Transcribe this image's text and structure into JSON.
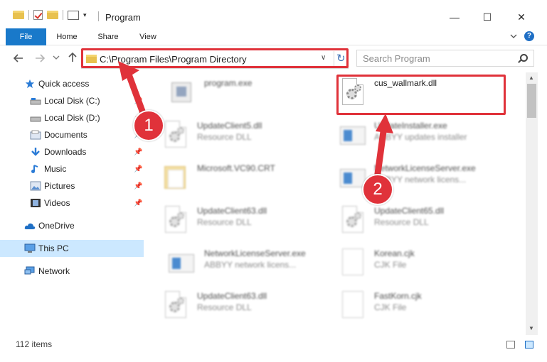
{
  "window": {
    "title": "Program",
    "minimize": "—",
    "maximize": "☐",
    "close": "✕"
  },
  "ribbon": {
    "tabs": [
      "File",
      "Home",
      "Share",
      "View"
    ],
    "help": "?"
  },
  "address": {
    "path": "C:\\Program Files\\Program Directory",
    "search_placeholder": "Search Program"
  },
  "nav_pane": {
    "quick_access": "Quick access",
    "items": [
      {
        "label": "Local Disk (C:)",
        "icon": "drive-icon",
        "pinned": true
      },
      {
        "label": "Local Disk (D:)",
        "icon": "drive-icon",
        "pinned": true
      },
      {
        "label": "Documents",
        "icon": "documents-icon",
        "pinned": true
      },
      {
        "label": "Downloads",
        "icon": "download-icon",
        "pinned": true
      },
      {
        "label": "Music",
        "icon": "music-icon",
        "pinned": true
      },
      {
        "label": "Pictures",
        "icon": "pictures-icon",
        "pinned": true
      },
      {
        "label": "Videos",
        "icon": "videos-icon",
        "pinned": true
      }
    ],
    "onedrive": "OneDrive",
    "this_pc": "This PC",
    "network": "Network"
  },
  "files": [
    {
      "name": "program.exe",
      "desc": "",
      "icon": "program-icon"
    },
    {
      "name": "cus_wallmark.dll",
      "desc": "",
      "icon": "dll-icon"
    },
    {
      "name": "UpdateClient5.dll",
      "desc": "Resource DLL",
      "icon": "dll-icon"
    },
    {
      "name": "UpdateInstaller.exe",
      "desc": "ABBYY updates installer",
      "icon": "exe-icon"
    },
    {
      "name": "Microsoft.VC90.CRT",
      "desc": "",
      "icon": "folder-icon"
    },
    {
      "name": "NetworkLicenseServer.exe",
      "desc": "ABBYY network licens...",
      "icon": "exe-icon"
    },
    {
      "name": "UpdateClient63.dll",
      "desc": "Resource DLL",
      "icon": "dll-icon"
    },
    {
      "name": "UpdateClient65.dll",
      "desc": "Resource DLL",
      "icon": "dll-icon"
    },
    {
      "name": "NetworkLicenseServer.exe",
      "desc": "ABBYY network licens...",
      "icon": "exe-icon"
    },
    {
      "name": "Korean.cjk",
      "desc": "CJK File",
      "icon": "file-icon"
    },
    {
      "name": "UpdateClient63.dll",
      "desc": "Resource DLL",
      "icon": "dll-icon"
    },
    {
      "name": "FastKorn.cjk",
      "desc": "CJK File",
      "icon": "file-icon"
    }
  ],
  "status": {
    "item_count": "112 items"
  },
  "annotations": {
    "step1": "1",
    "step2": "2",
    "color": "#e0323a"
  }
}
